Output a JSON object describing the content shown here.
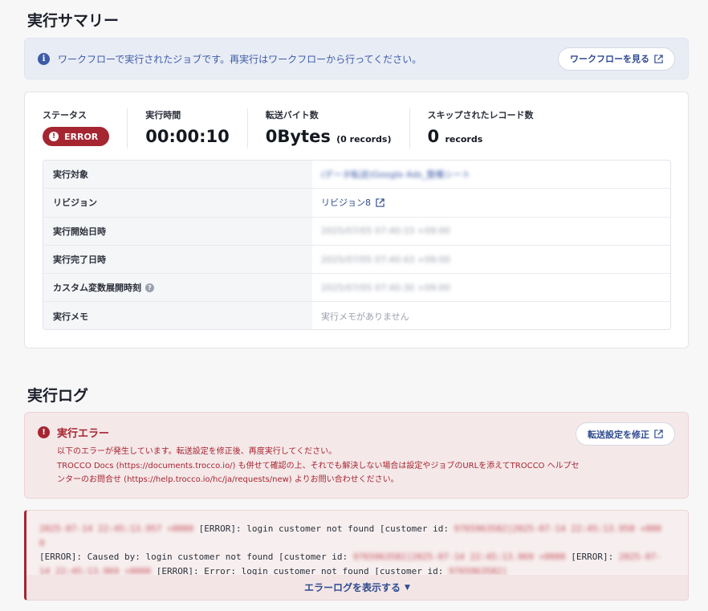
{
  "summary": {
    "title": "実行サマリー",
    "info_text": "ワークフローで実行されたジョブです。再実行はワークフローから行ってください。",
    "view_workflow_label": "ワークフローを見る",
    "stats": {
      "status_label": "ステータス",
      "status_value": "ERROR",
      "duration_label": "実行時間",
      "duration_value": "00:00:10",
      "bytes_label": "転送バイト数",
      "bytes_value": "0Bytes",
      "bytes_records": "(0 records)",
      "skipped_label": "スキップされたレコード数",
      "skipped_value": "0",
      "skipped_unit": "records"
    },
    "details": [
      {
        "key": "実行対象",
        "value": "(データ転送)Google Ads_整備シート"
      },
      {
        "key": "リビジョン",
        "value": "リビジョン8"
      },
      {
        "key": "実行開始日時",
        "value": "2025/07/05 07:40:33 +09:00"
      },
      {
        "key": "実行完了日時",
        "value": "2025/07/05 07:40:43 +09:00"
      },
      {
        "key": "カスタム変数展開時刻",
        "value": "2025/07/05 07:40:30 +09:00"
      },
      {
        "key": "実行メモ",
        "value": "実行メモがありません"
      }
    ]
  },
  "log": {
    "title": "実行ログ",
    "error_title": "実行エラー",
    "error_line1": "以下のエラーが発生しています。転送設定を修正後、再度実行してください。",
    "error_line2": "TROCCO Docs (https://documents.trocco.io/) も併せて確認の上、それでも解決しない場合は設定やジョブのURLを添えてTROCCO ヘルプセンターのお問合せ (https://help.trocco.io/hc/ja/requests/new) よりお問い合わせください。",
    "fix_config_label": "転送設定を修正",
    "log_parts": {
      "ts1": "2025-07-14 22:45:13.957 +0000",
      "msg1": " [ERROR]: login customer not found [customer id: ",
      "id1": "9765963582]2025-07-14 22:45:13.958 +0000",
      "msg2": "[ERROR]: Caused by: login customer not found [customer id: ",
      "id2": "9765963582]2025-07-14 22:45:13.969 +0000",
      "msg3": " [ERROR]: ",
      "ts3": "2025-07-14 22:45:13.969 +0000",
      "msg4": " [ERROR]: Error: login customer not found [customer id: ",
      "id3": "9765963582]"
    },
    "show_log_label": "エラーログを表示する"
  }
}
